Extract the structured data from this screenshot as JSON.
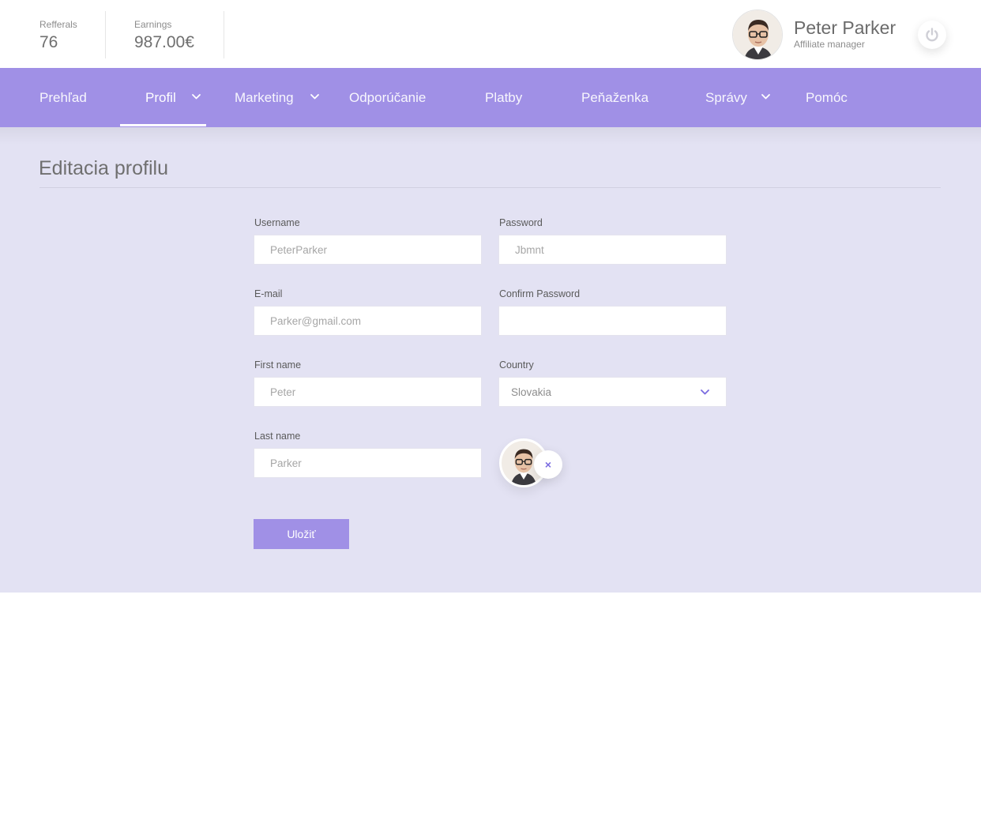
{
  "header": {
    "stats": [
      {
        "label": "Refferals",
        "value": "76"
      },
      {
        "label": "Earnings",
        "value": "987.00€"
      }
    ],
    "user": {
      "name": "Peter Parker",
      "role": "Affiliate manager"
    },
    "power_icon": "power-icon"
  },
  "nav": {
    "items": [
      {
        "label": "Prehľad",
        "has_dropdown": false
      },
      {
        "label": "Profil",
        "has_dropdown": true,
        "active": true
      },
      {
        "label": "Marketing",
        "has_dropdown": true
      },
      {
        "label": "Odporúčanie",
        "has_dropdown": false
      },
      {
        "label": "Platby",
        "has_dropdown": false
      },
      {
        "label": "Peňaženka",
        "has_dropdown": false
      },
      {
        "label": "Správy",
        "has_dropdown": true
      },
      {
        "label": "Pomóc",
        "has_dropdown": false
      }
    ]
  },
  "page": {
    "title": "Editacia profilu"
  },
  "form": {
    "username": {
      "label": "Username",
      "placeholder": "PeterParker"
    },
    "password": {
      "label": "Password",
      "placeholder": "Jbmnt"
    },
    "email": {
      "label": "E-mail",
      "placeholder": "Parker@gmail.com"
    },
    "confirm_password": {
      "label": "Confirm Password",
      "placeholder": ""
    },
    "first_name": {
      "label": "First name",
      "placeholder": "Peter"
    },
    "country": {
      "label": "Country",
      "value": "Slovakia"
    },
    "last_name": {
      "label": "Last name",
      "placeholder": "Parker"
    },
    "remove_photo_symbol": "×",
    "save_label": "Uložiť"
  },
  "colors": {
    "accent": "#a090e6",
    "background": "#e3e2f3",
    "remove_icon": "#7a6be0"
  }
}
